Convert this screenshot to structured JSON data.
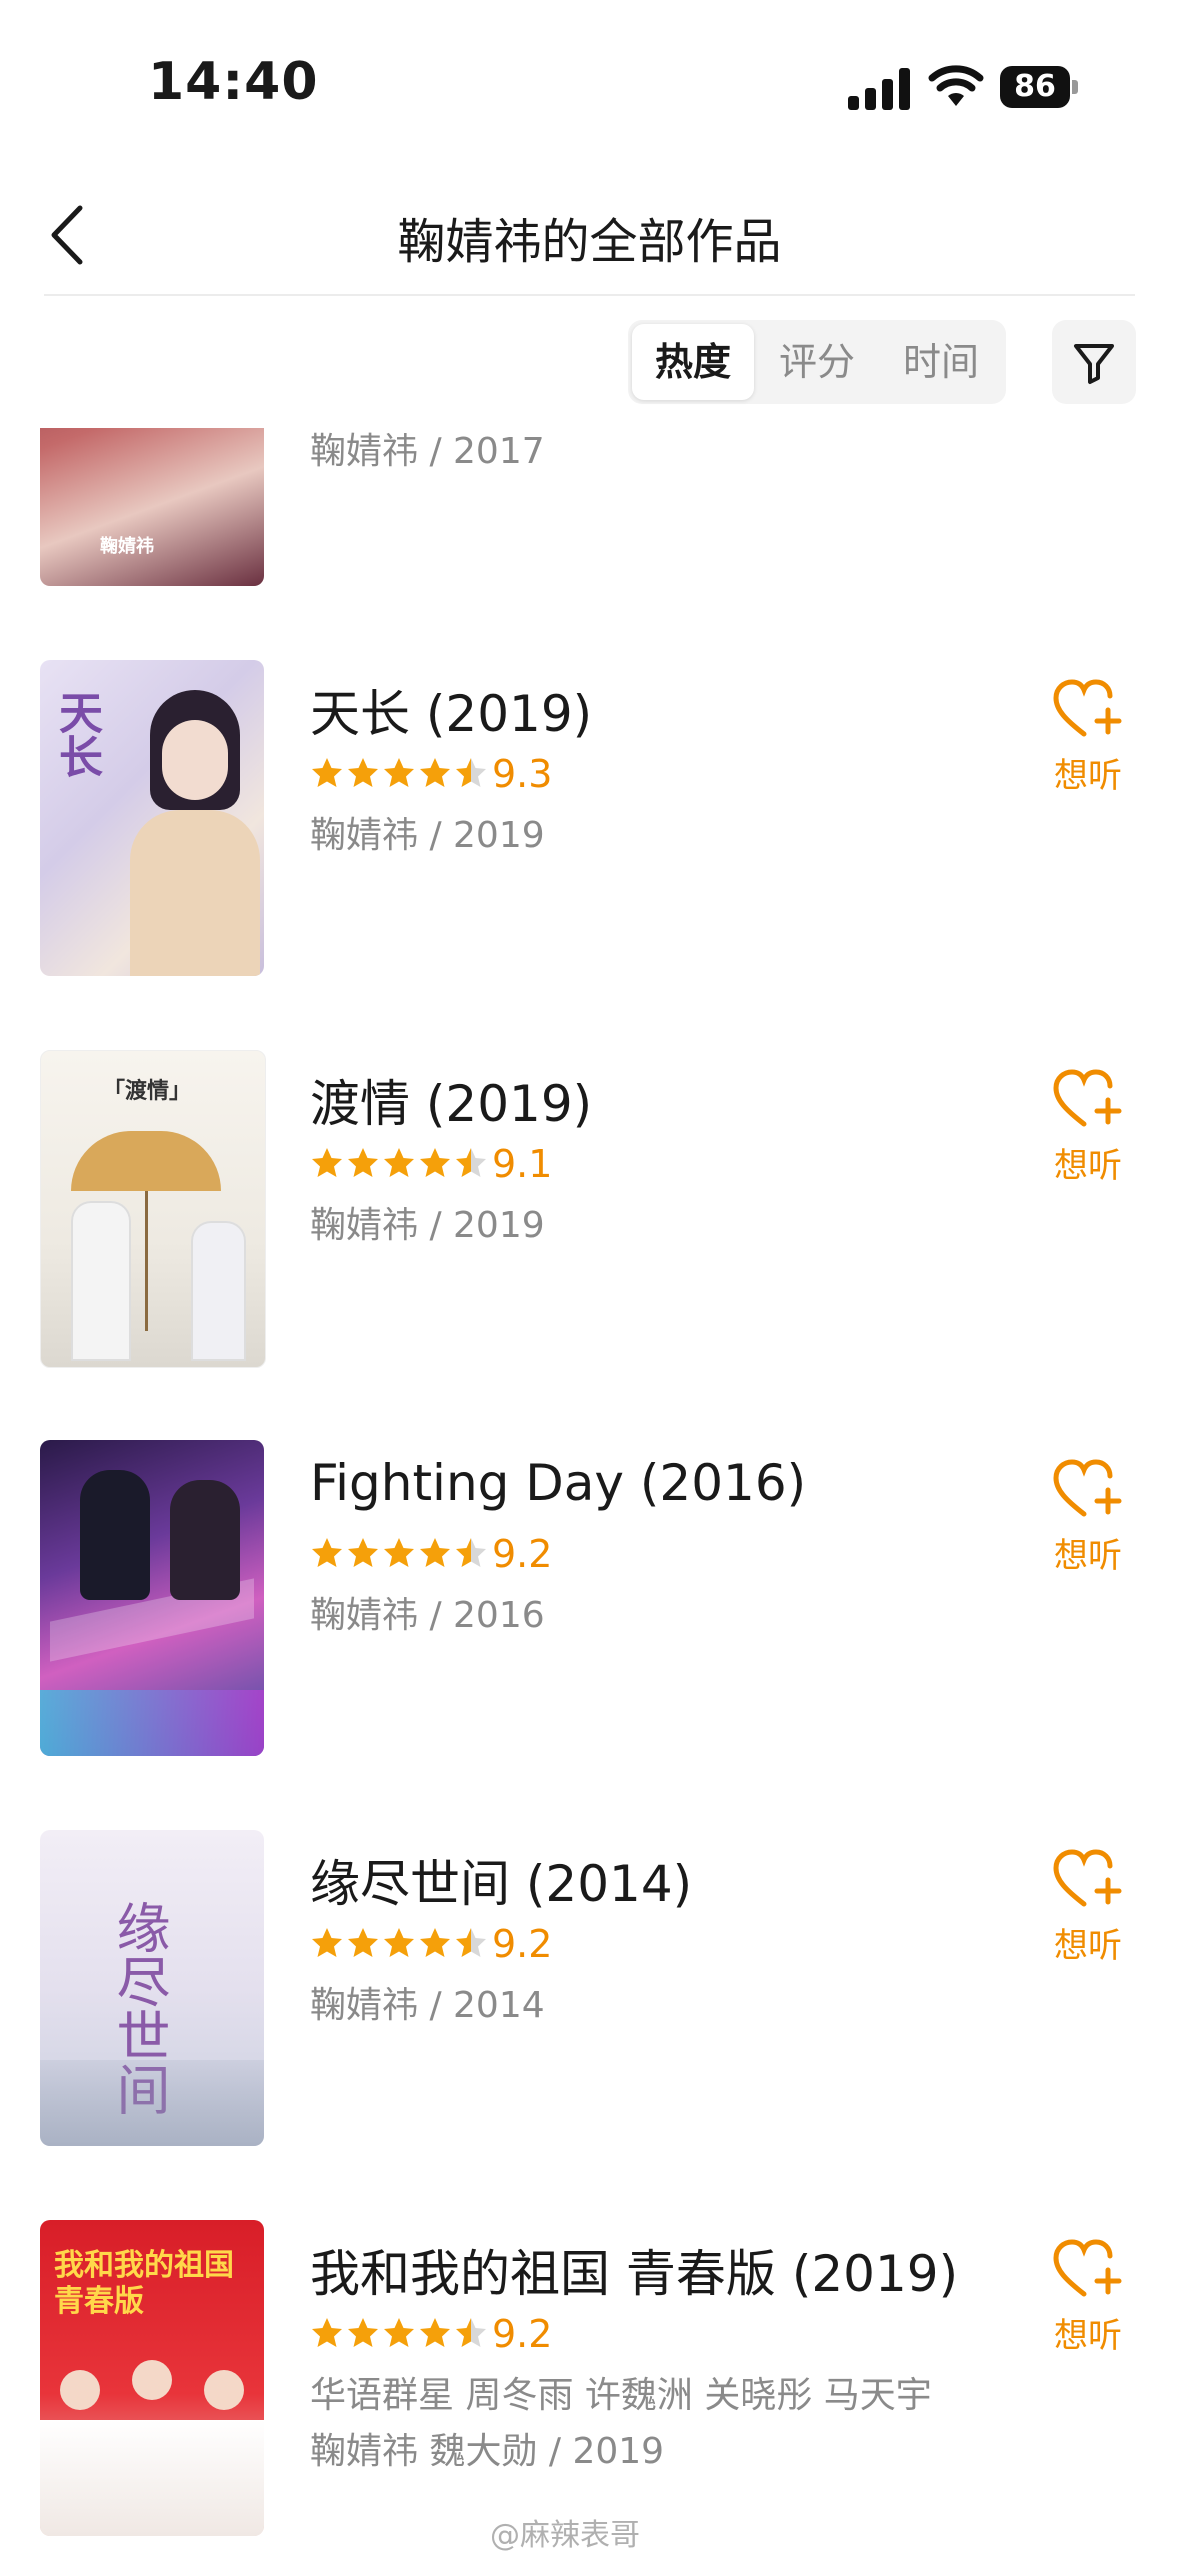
{
  "status_bar": {
    "time": "14:40",
    "battery": "86"
  },
  "nav": {
    "title": "鞠婧祎的全部作品"
  },
  "sort": {
    "tabs": [
      "热度",
      "评分",
      "时间"
    ],
    "active": "热度"
  },
  "colors": {
    "accent": "#f08c00",
    "star": "#f5a00a",
    "gray_text": "#8a8a8a"
  },
  "partial_item": {
    "meta": "鞠婧祎 / 2017",
    "cover_text": "鞠婧祎"
  },
  "items": [
    {
      "title": "天长",
      "year": "(2019)",
      "score": "9.3",
      "rating": 4.5,
      "meta": "鞠婧祎 / 2019",
      "want_label": "想听",
      "cover_text": "天长"
    },
    {
      "title": "渡情",
      "year": "(2019)",
      "score": "9.1",
      "rating": 4.5,
      "meta": "鞠婧祎 / 2019",
      "want_label": "想听",
      "cover_text": "「渡情」"
    },
    {
      "title": "Fighting Day",
      "year": "(2016)",
      "score": "9.2",
      "rating": 4.5,
      "meta": "鞠婧祎 / 2016",
      "want_label": "想听",
      "cover_text": ""
    },
    {
      "title": "缘尽世间",
      "year": "(2014)",
      "score": "9.2",
      "rating": 4.5,
      "meta": "鞠婧祎 / 2014",
      "want_label": "想听",
      "cover_text": "缘尽世间"
    },
    {
      "title": "我和我的祖国 青春版",
      "year": "(2019)",
      "score": "9.2",
      "rating": 4.5,
      "meta": "华语群星 周冬雨 许魏洲 关晓彤 马天宇 鞠婧祎 魏大勋 / 2019",
      "want_label": "想听",
      "cover_text": "我和我的祖国 青春版"
    }
  ],
  "watermark": "@麻辣表哥"
}
